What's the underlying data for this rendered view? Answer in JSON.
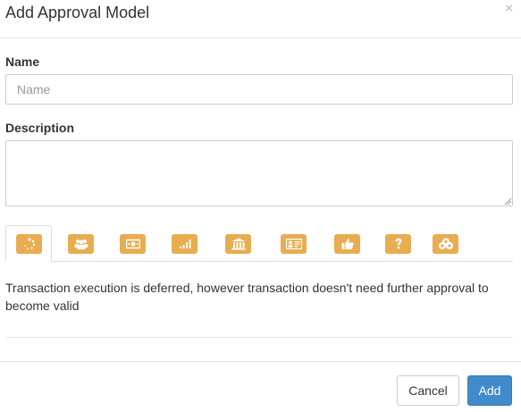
{
  "modal": {
    "title": "Add Approval Model",
    "close_glyph": "×"
  },
  "form": {
    "name_label": "Name",
    "name_placeholder": "Name",
    "name_value": "",
    "description_label": "Description",
    "description_value": ""
  },
  "tabs": [
    {
      "icon": "spinner-icon",
      "active": true
    },
    {
      "icon": "users-icon",
      "active": false
    },
    {
      "icon": "money-icon",
      "active": false
    },
    {
      "icon": "signal-icon",
      "active": false
    },
    {
      "icon": "bank-icon",
      "active": false
    },
    {
      "icon": "id-card-icon",
      "active": false
    },
    {
      "icon": "thumbs-up-icon",
      "active": false
    },
    {
      "icon": "question-icon",
      "active": false
    },
    {
      "icon": "coins-icon",
      "active": false
    }
  ],
  "tab_description": "Transaction execution is deferred, however transaction doesn't need further approval to become valid",
  "footer": {
    "cancel_label": "Cancel",
    "add_label": "Add"
  },
  "colors": {
    "tab_icon_bg": "#e8ad50",
    "primary": "#428bca"
  }
}
